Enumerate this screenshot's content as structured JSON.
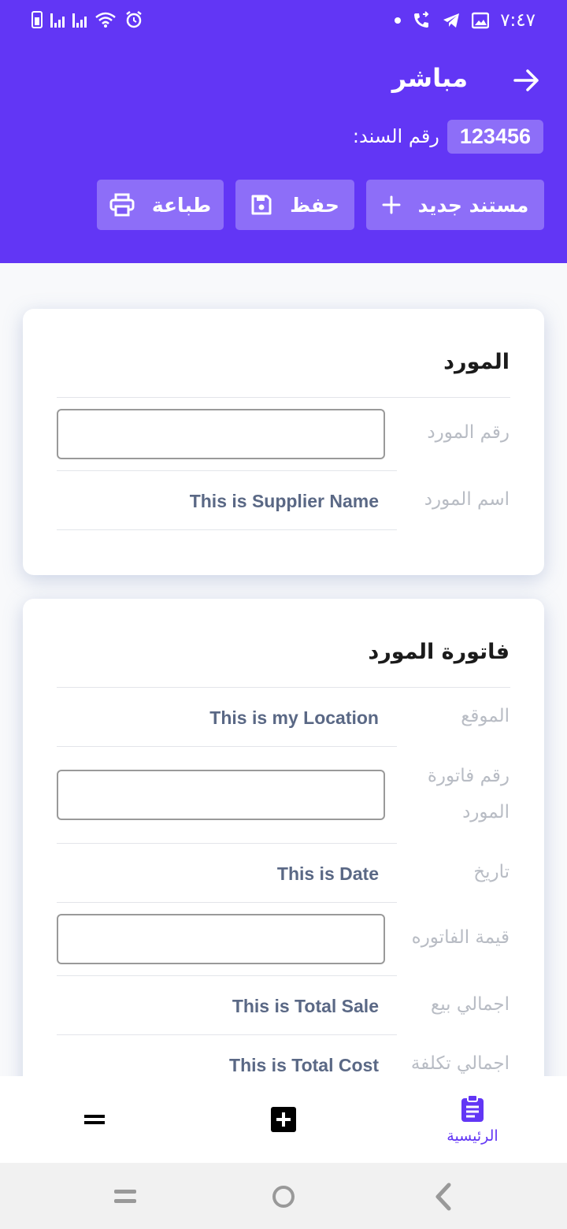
{
  "status_bar": {
    "time": "٧:٤٧",
    "left_icons": [
      "battery-charging-icon",
      "signal-icon",
      "signal-icon",
      "wifi-icon",
      "alarm-icon"
    ],
    "right_icons": [
      "notification-dot-icon",
      "call-forward-icon",
      "telegram-icon",
      "image-icon"
    ]
  },
  "header": {
    "title": "مباشر",
    "doc_label": "رقم السند:",
    "doc_number": "123456",
    "colors": {
      "background": "#6236f5",
      "button_bg": "rgba(255,255,255,0.28)"
    }
  },
  "actions": {
    "new_doc_label": "مستند جديد",
    "save_label": "حفظ",
    "print_label": "طباعة"
  },
  "supplier_card": {
    "title": "المورد",
    "supplier_number_label": "رقم المورد",
    "supplier_number_value": "",
    "supplier_name_label": "اسم المورد",
    "supplier_name_value": "This is Supplier Name"
  },
  "invoice_card": {
    "title": "فاتورة المورد",
    "location_label": "الموقع",
    "location_value": "This is my Location",
    "invoice_number_label": "رقم فاتورة المورد",
    "invoice_number_value": "",
    "date_label": "تاريخ",
    "date_value": "This is Date",
    "invoice_amount_label": "قيمة الفاتوره",
    "invoice_amount_value": "",
    "total_sale_label": "اجمالي بيع",
    "total_sale_value": "This is Total Sale",
    "total_cost_label": "اجمالي تكلفة",
    "total_cost_value": "This is Total Cost"
  },
  "bottom_nav": {
    "home_label": "الرئيسية",
    "accent_color": "#6236f5"
  }
}
